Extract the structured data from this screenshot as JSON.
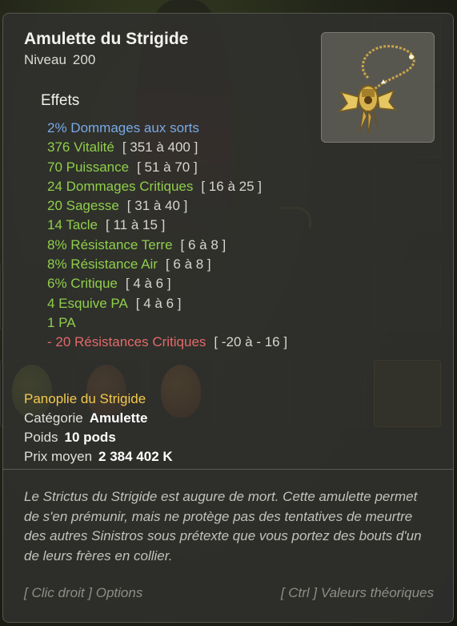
{
  "item": {
    "name": "Amulette du Strigide",
    "level_label": "Niveau",
    "level_value": "200",
    "icon": "amulet-icon"
  },
  "effects_heading": "Effets",
  "effects": [
    {
      "text": "2% Dommages aux sorts",
      "range": "",
      "color": "#78a9e6"
    },
    {
      "text": "376 Vitalité",
      "range": "[ 351 à 400 ]",
      "color": "#8fce4b"
    },
    {
      "text": "70 Puissance",
      "range": "[ 51 à 70 ]",
      "color": "#8fce4b"
    },
    {
      "text": "24 Dommages Critiques",
      "range": "[ 16 à 25 ]",
      "color": "#8fce4b"
    },
    {
      "text": "20 Sagesse",
      "range": "[ 31 à 40 ]",
      "color": "#8fce4b"
    },
    {
      "text": "14 Tacle",
      "range": "[ 11 à 15 ]",
      "color": "#8fce4b"
    },
    {
      "text": "8% Résistance Terre",
      "range": "[ 6 à 8 ]",
      "color": "#8fce4b"
    },
    {
      "text": "8% Résistance Air",
      "range": "[ 6 à 8 ]",
      "color": "#8fce4b"
    },
    {
      "text": "6% Critique",
      "range": "[ 4 à 6 ]",
      "color": "#8fce4b"
    },
    {
      "text": "4 Esquive PA",
      "range": "[ 4 à 6 ]",
      "color": "#8fce4b"
    },
    {
      "text": "1 PA",
      "range": "",
      "color": "#8fce4b"
    },
    {
      "text": "- 20 Résistances Critiques",
      "range": "[ -20 à - 16 ]",
      "color": "#e26a6a"
    }
  ],
  "panoplie": "Panoplie du Strigide",
  "category": {
    "label": "Catégorie",
    "value": "Amulette"
  },
  "weight": {
    "label": "Poids",
    "value": "10 pods"
  },
  "price": {
    "label": "Prix moyen",
    "value": "2 384 402 K"
  },
  "description": "Le Strictus du Strigide est augure de mort. Cette amulette permet de s'en prémunir, mais ne protège pas des tentatives de meurtre des autres Sinistros sous prétexte que vous portez des bouts d'un de leurs frères en collier.",
  "hints": {
    "right_click": "[ Clic droit ] Options",
    "ctrl": "[ Ctrl ] Valeurs théoriques"
  }
}
